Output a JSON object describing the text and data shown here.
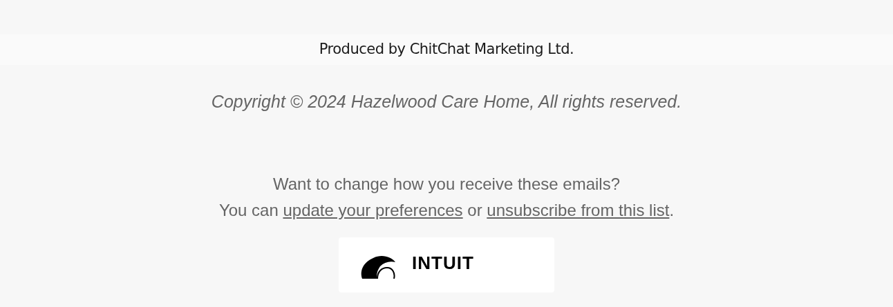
{
  "banner": {
    "text": "Produced by ChitChat Marketing Ltd."
  },
  "copyright": "Copyright © 2024 Hazelwood Care Home, All rights reserved.",
  "preferences": {
    "question": "Want to change how you receive these emails?",
    "lead": "You can",
    "link_update": "update your preferences",
    "middle": "or",
    "link_unsubscribe": "unsubscribe from this list",
    "end": "."
  },
  "badge": {
    "wordmark": "INTUIT"
  }
}
